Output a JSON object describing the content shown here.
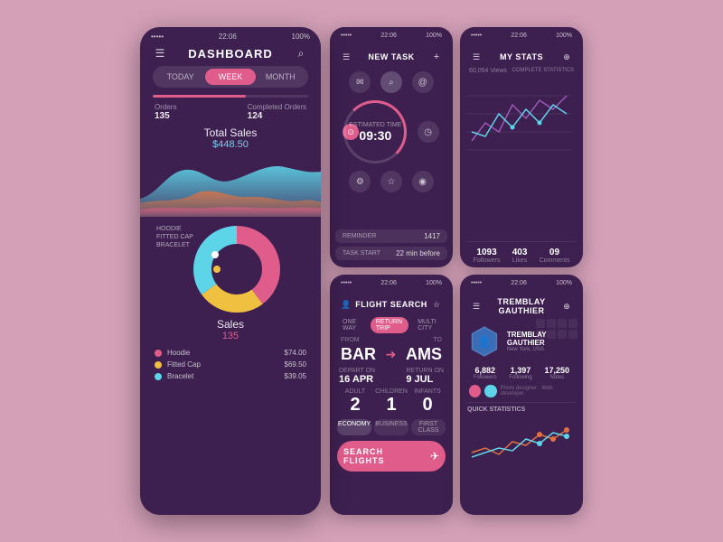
{
  "bg_color": "#d4a0b8",
  "dashboard": {
    "status_bar": {
      "dots": "•••••",
      "time": "22:06",
      "battery": "100%"
    },
    "title": "DASHBOARD",
    "tabs": [
      "TODAY",
      "WEEK",
      "MONTH"
    ],
    "active_tab": 1,
    "orders_label": "Orders",
    "orders_value": "135",
    "completed_label": "Completed Orders",
    "completed_value": "124",
    "total_sales_title": "Total Sales",
    "total_sales_amount": "$448.50",
    "sales_title": "Sales",
    "sales_count": "135",
    "legend": [
      {
        "name": "Hoodie",
        "price": "$74.00",
        "color": "#e05c8a"
      },
      {
        "name": "Fitted Cap",
        "price": "$69.50",
        "color": "#f0c040"
      },
      {
        "name": "Bracelet",
        "price": "$39.05",
        "color": "#5dd4e8"
      }
    ],
    "donut_labels": [
      "HOODIE",
      "FITTED CAP",
      "BRACELET"
    ]
  },
  "new_task": {
    "title": "NEW TASK",
    "timer_label": "ESTIMATED TIME",
    "timer_value": "09:30",
    "reminder_label": "REMINDER",
    "reminder_value": "1417",
    "task_start_label": "TASK START",
    "task_start_value": "22 min before"
  },
  "my_stats": {
    "title": "MY STATS",
    "subtitle": "COMPLETE STATISTICS",
    "views_label": "60,054 Views",
    "followers_value": "1093",
    "followers_label": "Followers",
    "likes_value": "403",
    "likes_label": "Likes",
    "comments_value": "09",
    "comments_label": "Comments"
  },
  "flight_search": {
    "title": "FLIGHT SEARCH",
    "tabs": [
      "ONE WAY",
      "RETURN TRIP",
      "MULTI CITY"
    ],
    "active_tab": 1,
    "from_label": "FROM",
    "from_city": "BAR",
    "to_label": "TO",
    "to_city": "AMS",
    "depart_label": "DEPART ON",
    "depart_date": "16 APR",
    "return_label": "RETURN ON",
    "return_date": "9 JUL",
    "adult_label": "ADULT",
    "adult_count": "2",
    "children_label": "CHILDREN",
    "children_count": "1",
    "infants_label": "INFANTS",
    "infants_count": "0",
    "classes": [
      "ECONOMY",
      "BUSINESS",
      "FIRST CLASS"
    ],
    "active_class": 0,
    "search_btn": "SEARCH FLIGHTS"
  },
  "profile": {
    "title": "TREMBLAY GAUTHIER",
    "location": "New York, USA",
    "followers_value": "6,882",
    "followers_label": "Followers",
    "following_value": "1,397",
    "following_label": "Following",
    "notes_value": "17,250",
    "notes_label": "Notes",
    "quick_stats_title": "QUICK STATISTICS"
  },
  "icons": {
    "menu": "☰",
    "search": "⌕",
    "back": "←",
    "plus": "+",
    "star": "☆",
    "mail": "✉",
    "at": "@",
    "clock": "◷",
    "pin": "⊙",
    "settings": "⚙",
    "smile": "☺",
    "bell": "◉",
    "plane": "✈",
    "person": "👤"
  }
}
